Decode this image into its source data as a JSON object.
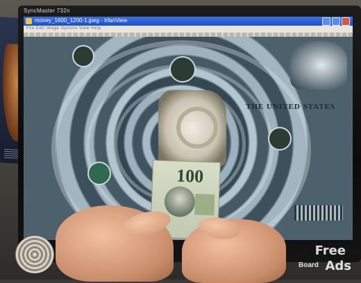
{
  "monitor": {
    "brand": "SyncMaster 732n"
  },
  "window": {
    "title": "money_1600_1200-1.jpeg - IrfanView",
    "menu_text": "File  Edit  Image  Options  View  Help"
  },
  "image_content": {
    "bill_text": "THE UNITED STATES",
    "bill_denomination": "100"
  },
  "watermark": {
    "line1": "Free",
    "line2": "Board",
    "line3": "Ads"
  }
}
